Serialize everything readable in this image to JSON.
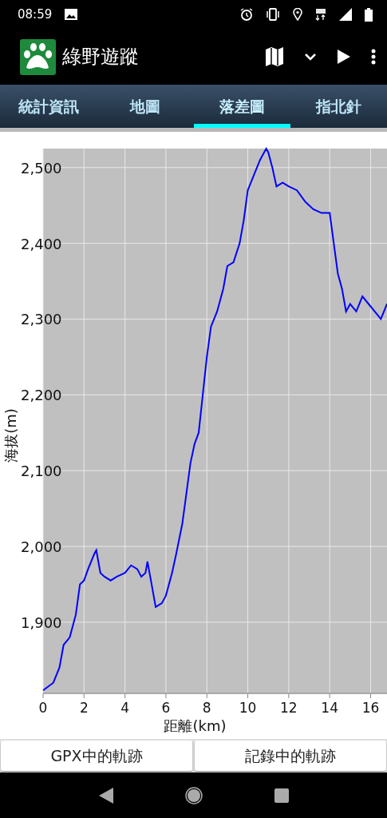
{
  "status_bar": {
    "time": "08:59"
  },
  "app_bar": {
    "title": "綠野遊蹤"
  },
  "tabs": [
    {
      "label": "統計資訊",
      "selected": false
    },
    {
      "label": "地圖",
      "selected": false
    },
    {
      "label": "落差圖",
      "selected": true
    },
    {
      "label": "指北針",
      "selected": false
    }
  ],
  "elevation_chart": {
    "chart_data": {
      "type": "line",
      "xlabel": "距離(km)",
      "ylabel": "海拔(m)",
      "x": [
        0,
        0.5,
        0.8,
        1.0,
        1.3,
        1.6,
        1.8,
        2.0,
        2.2,
        2.5,
        2.6,
        2.8,
        3.0,
        3.3,
        3.6,
        4.0,
        4.3,
        4.6,
        4.8,
        5.0,
        5.1,
        5.3,
        5.5,
        5.8,
        6.0,
        6.3,
        6.5,
        6.8,
        7.0,
        7.2,
        7.4,
        7.6,
        7.8,
        8.0,
        8.2,
        8.5,
        8.8,
        9.0,
        9.3,
        9.6,
        9.8,
        10.0,
        10.3,
        10.6,
        10.9,
        11.0,
        11.2,
        11.4,
        11.7,
        12.0,
        12.4,
        12.8,
        13.2,
        13.6,
        14.0,
        14.2,
        14.4,
        14.6,
        14.8,
        15.0,
        15.3,
        15.6,
        15.9,
        16.2,
        16.5,
        16.8
      ],
      "grid": true,
      "series": [
        {
          "color": "#0000ff",
          "values": [
            1810,
            1820,
            1840,
            1870,
            1880,
            1910,
            1950,
            1955,
            1970,
            1990,
            1995,
            1965,
            1960,
            1955,
            1960,
            1965,
            1975,
            1970,
            1960,
            1965,
            1980,
            1950,
            1920,
            1925,
            1935,
            1965,
            1990,
            2030,
            2070,
            2110,
            2135,
            2150,
            2200,
            2250,
            2290,
            2310,
            2340,
            2370,
            2375,
            2400,
            2430,
            2470,
            2490,
            2510,
            2525,
            2520,
            2500,
            2475,
            2480,
            2475,
            2470,
            2455,
            2445,
            2440,
            2440,
            2400,
            2360,
            2340,
            2310,
            2320,
            2310,
            2330,
            2320,
            2310,
            2300,
            2320
          ]
        }
      ],
      "xlim": [
        0,
        16.8
      ],
      "ylim": [
        1806,
        2525
      ],
      "xticks": [
        0,
        2,
        4,
        6,
        8,
        10,
        12,
        14,
        16
      ],
      "yticks": [
        {
          "value": 1900,
          "label": "1,900"
        },
        {
          "value": 2000,
          "label": "2,000"
        },
        {
          "value": 2100,
          "label": "2,100"
        },
        {
          "value": 2200,
          "label": "2,200"
        },
        {
          "value": 2300,
          "label": "2,300"
        },
        {
          "value": 2400,
          "label": "2,400"
        },
        {
          "value": 2500,
          "label": "2,500"
        }
      ]
    }
  },
  "buttons": [
    "GPX中的軌跡",
    "記錄中的軌跡"
  ]
}
